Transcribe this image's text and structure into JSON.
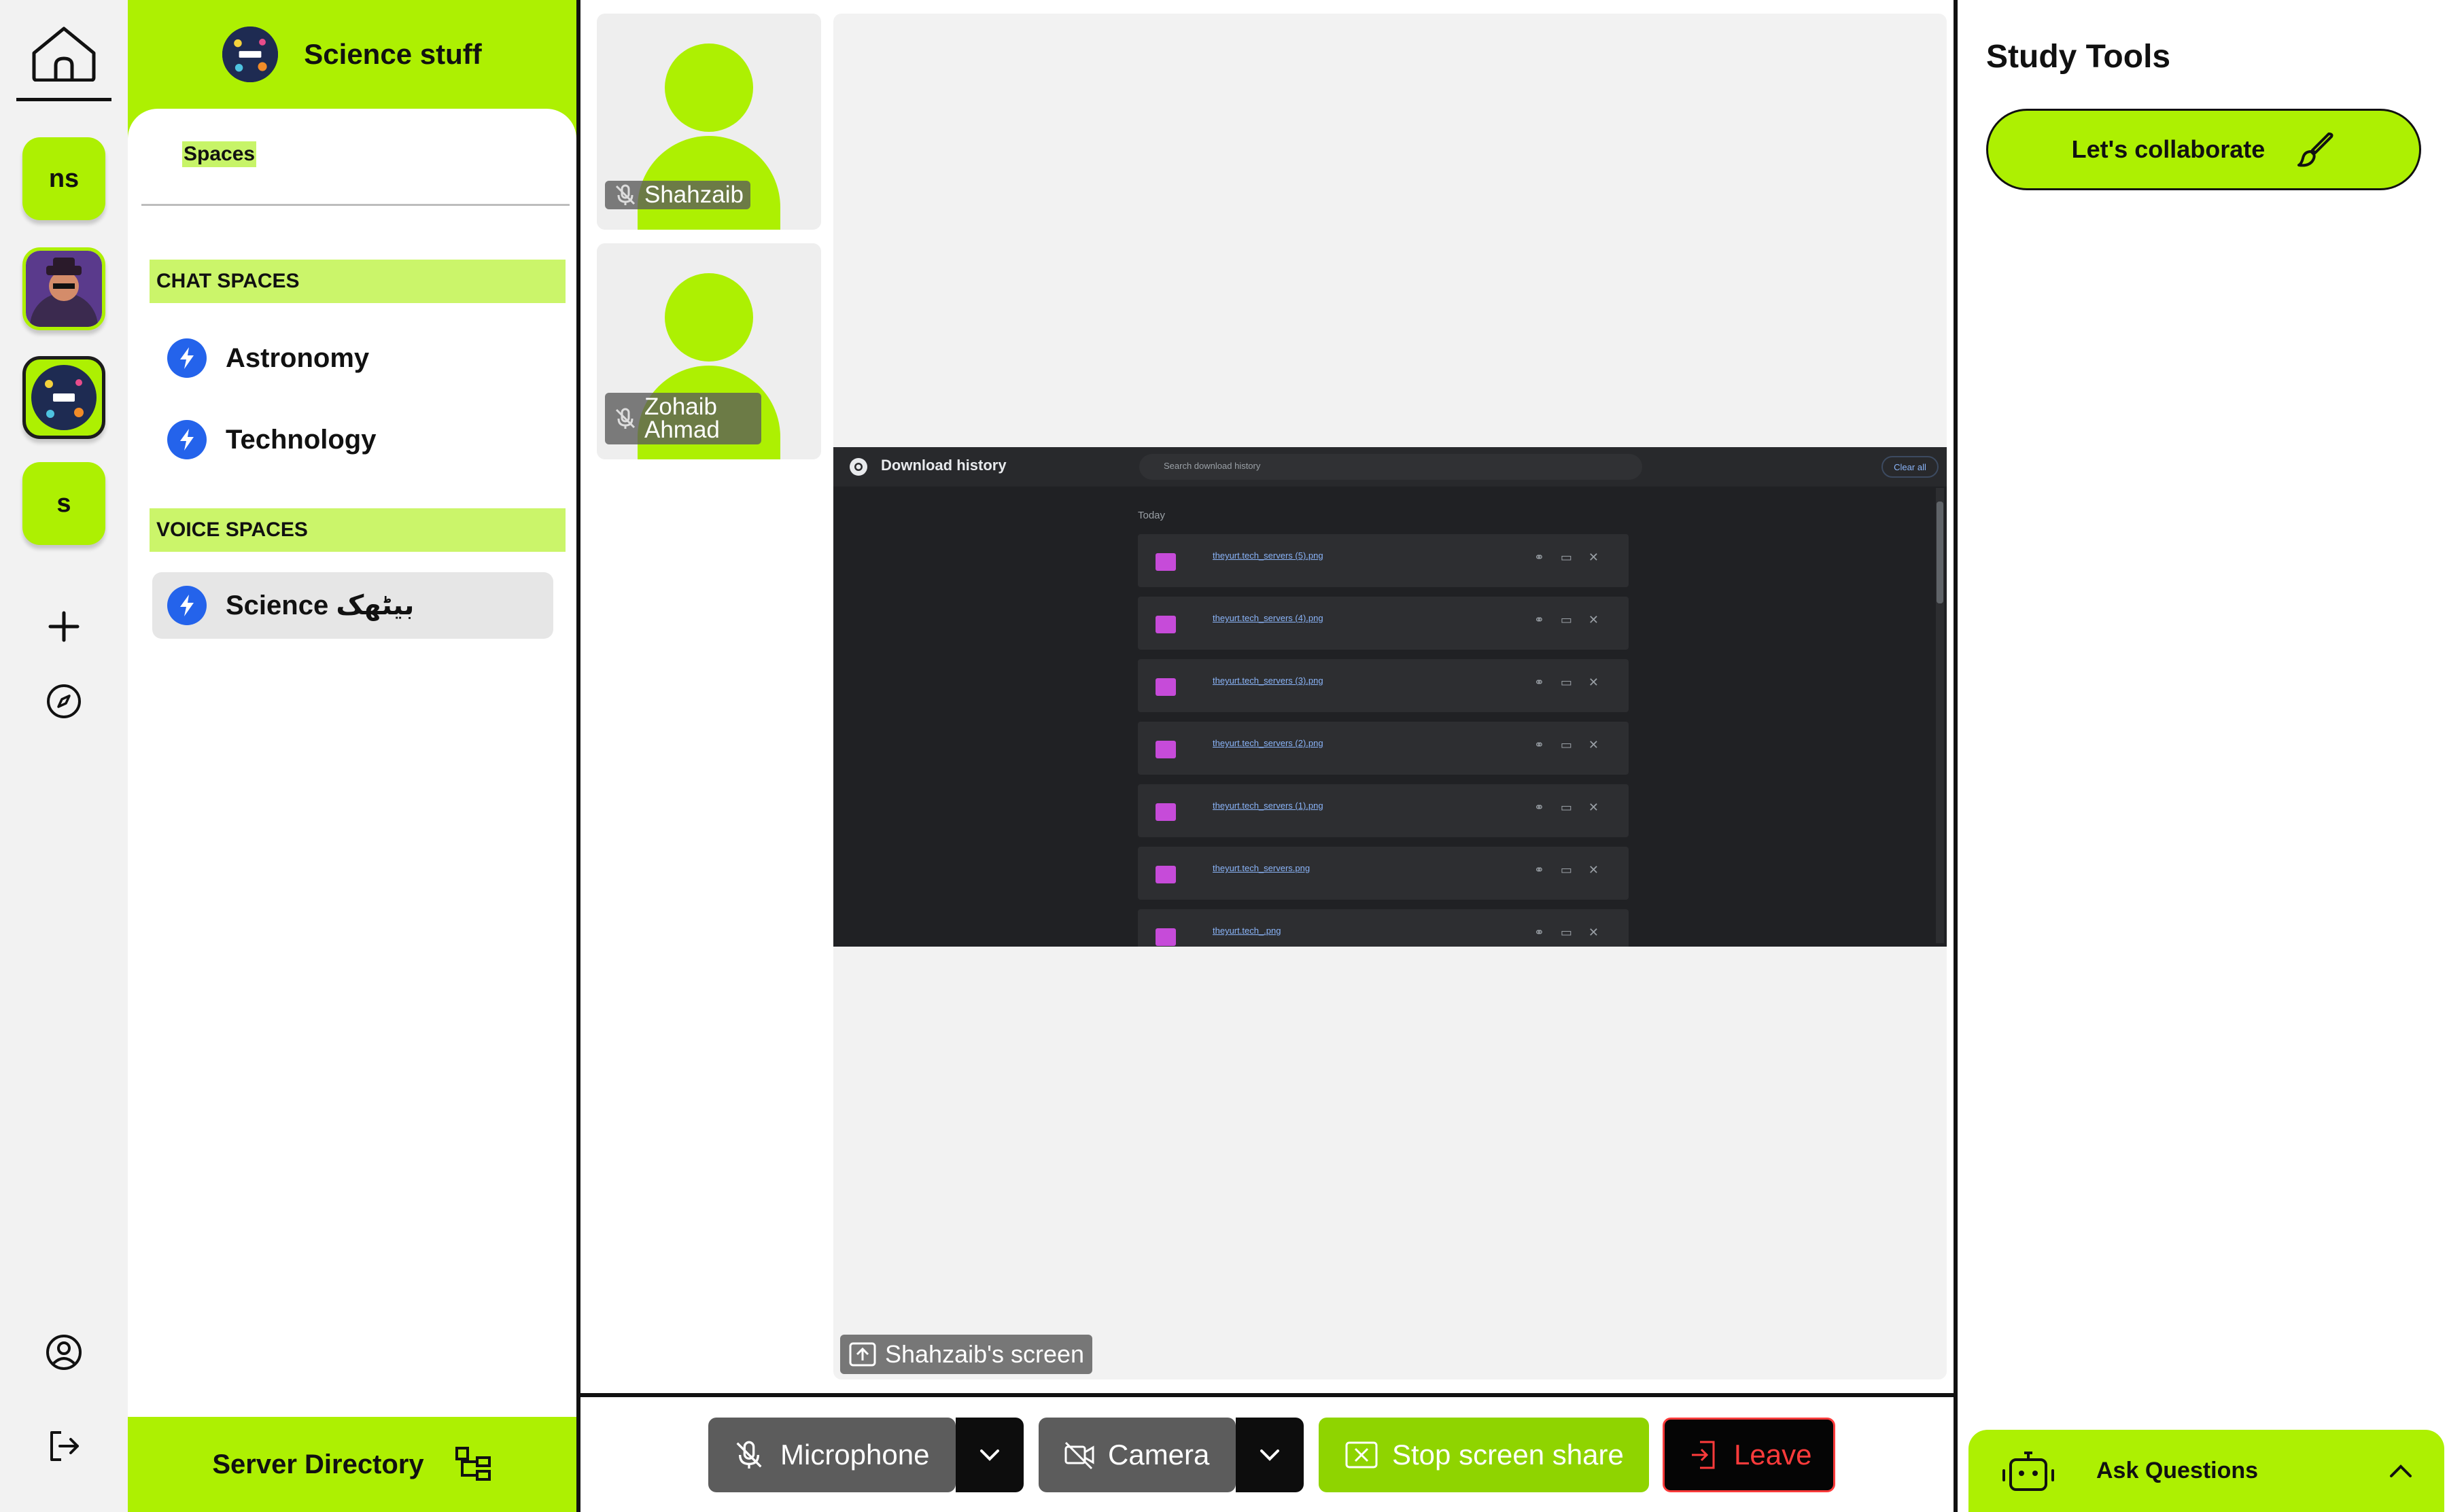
{
  "rail": {
    "servers": [
      {
        "initials": "ns"
      },
      {
        "initials": "s"
      }
    ]
  },
  "server": {
    "title": "Science stuff",
    "spaces_tab": "Spaces",
    "chat_header": "CHAT SPACES",
    "voice_header": "VOICE SPACES",
    "chat_channels": [
      "Astronomy",
      "Technology"
    ],
    "voice_channels": [
      "Science بیٹھک"
    ],
    "directory_label": "Server Directory"
  },
  "participants": [
    {
      "name": "Shahzaib"
    },
    {
      "name": "Zohaib Ahmad"
    }
  ],
  "share": {
    "window_title": "Download history",
    "search_placeholder": "Search download history",
    "clear_label": "Clear all",
    "section": "Today",
    "files": [
      "theyurt.tech_servers (5).png",
      "theyurt.tech_servers (4).png",
      "theyurt.tech_servers (3).png",
      "theyurt.tech_servers (2).png",
      "theyurt.tech_servers (1).png",
      "theyurt.tech_servers.png",
      "theyurt.tech_.png"
    ],
    "screen_label": "Shahzaib's screen"
  },
  "controls": {
    "microphone": "Microphone",
    "camera": "Camera",
    "stop_share": "Stop screen share",
    "leave": "Leave"
  },
  "study": {
    "title": "Study Tools",
    "collaborate": "Let's collaborate",
    "ask": "Ask Questions"
  },
  "colors": {
    "accent": "#adf002",
    "bolt_blue": "#2463eb",
    "leave_red": "#ff3b3b"
  }
}
